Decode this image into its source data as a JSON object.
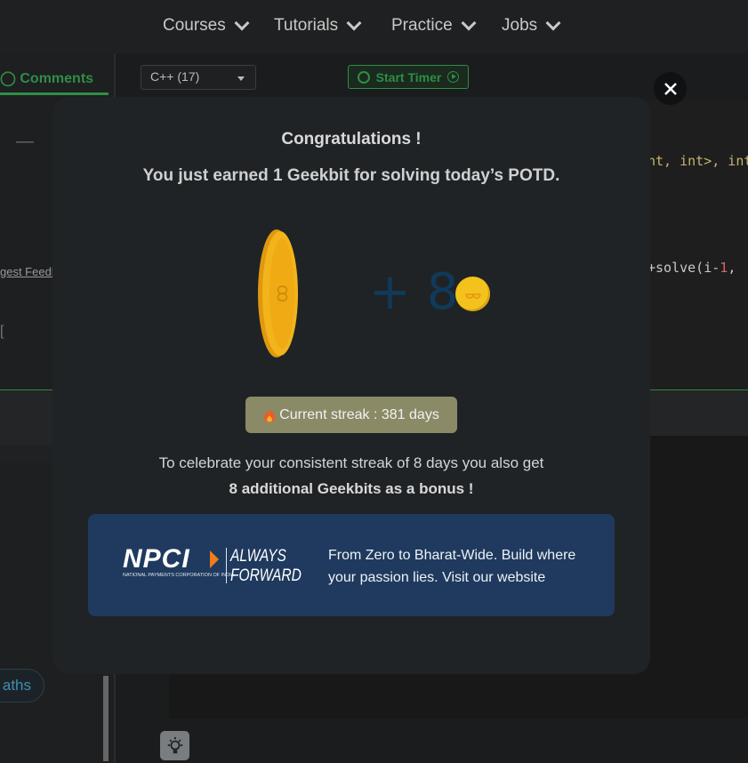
{
  "nav": {
    "items": [
      {
        "label": "Courses"
      },
      {
        "label": "Tutorials"
      },
      {
        "label": "Practice"
      },
      {
        "label": "Jobs"
      }
    ]
  },
  "left_panel": {
    "tab_comments": "Comments",
    "feedback_link": "gest Feedb",
    "bracket": "[",
    "dash": "—",
    "pill": "aths"
  },
  "editor": {
    "language": "C++ (17)",
    "timer_label": "Start Timer",
    "code_line1": "nt, int>, int",
    "code_line2_a": "+solve(i-",
    "code_line2_num": "1",
    "code_line2_b": ","
  },
  "modal": {
    "title": "Congratulations !",
    "subtitle": "You just earned 1 Geekbit for solving today’s POTD.",
    "bonus_text": "+ 8",
    "streak": "Current streak : 381 days",
    "celebrate_line1": "To celebrate your consistent streak of 8 days you also get",
    "celebrate_line2": "8 additional Geekbits as a bonus !",
    "ad": {
      "brand": "NPCI",
      "brand_small": "NATIONAL PAYMENTS CORPORATION OF INDIA",
      "tag1": "ALWAYS",
      "tag2": "FORWARD",
      "text": "From Zero to Bharat-Wide. Build where your passion lies. Visit our website"
    }
  },
  "colors": {
    "accent_green": "#2f8d46",
    "modal_bg": "#1f2326",
    "coin": "#f3c21d",
    "streak_bg": "#8b8a67",
    "ad_bg": "#1f3a5e"
  },
  "icons": [
    "chevron-down-icon",
    "timer-icon",
    "play-icon",
    "close-icon",
    "coin-icon",
    "fire-icon",
    "bulb-icon"
  ]
}
